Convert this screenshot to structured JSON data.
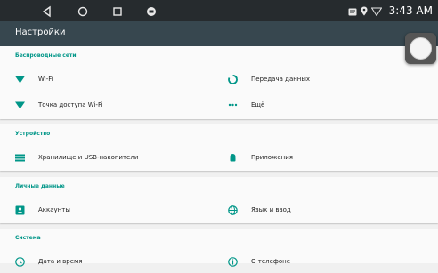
{
  "status_bar": {
    "time": "3:43 AM",
    "nav_icons": [
      "back-icon",
      "home-icon",
      "recents-icon",
      "app-icon"
    ],
    "status_icons": [
      "notification-icon",
      "location-icon",
      "wifi-icon"
    ]
  },
  "action_bar": {
    "title": "Настройки"
  },
  "colors": {
    "accent": "#009688",
    "action_bar": "#37474f",
    "status_bar": "#262b2e"
  },
  "sections": [
    {
      "header": "Беспроводные сети",
      "items": [
        {
          "label": "Wi-Fi",
          "icon": "wifi-icon"
        },
        {
          "label": "Передача данных",
          "icon": "data-usage-icon"
        },
        {
          "label": "Точка доступа Wi-Fi",
          "icon": "wifi-icon"
        },
        {
          "label": "Ещё",
          "icon": "more-icon"
        }
      ]
    },
    {
      "header": "Устройство",
      "items": [
        {
          "label": "Хранилище и USB-накопители",
          "icon": "storage-icon"
        },
        {
          "label": "Приложения",
          "icon": "android-icon"
        }
      ]
    },
    {
      "header": "Личные данные",
      "items": [
        {
          "label": "Аккаунты",
          "icon": "account-icon"
        },
        {
          "label": "Язык и ввод",
          "icon": "globe-icon"
        }
      ]
    },
    {
      "header": "Система",
      "items": [
        {
          "label": "Дата и время",
          "icon": "clock-icon"
        },
        {
          "label": "О телефоне",
          "icon": "info-icon"
        }
      ]
    }
  ]
}
